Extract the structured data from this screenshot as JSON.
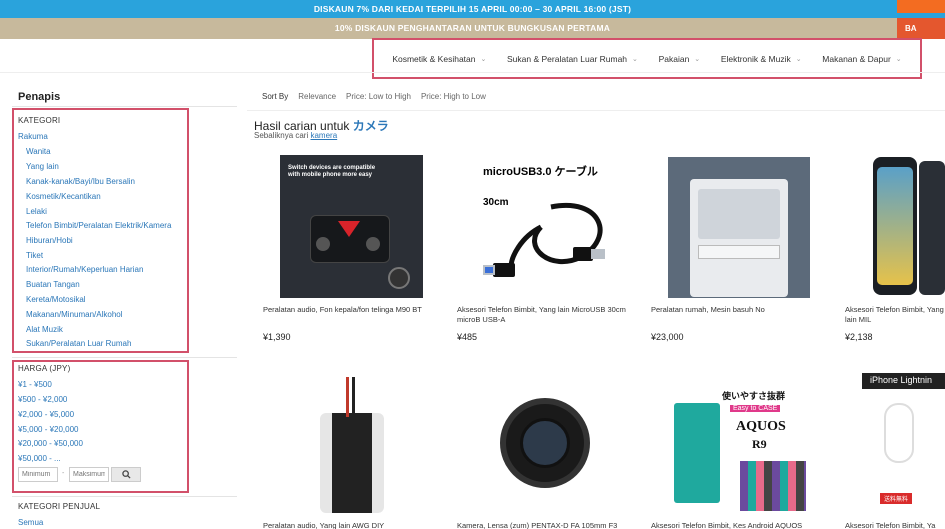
{
  "banners": {
    "top": "DISKAUN 7% DARI KEDAI TERPILIH 15 APRIL 00:00 – 30 APRIL 16:00 (JST)",
    "second": "10% DISKAUN PENGHANTARAN UNTUK BUNGKUSAN PERTAMA",
    "side_second": "BA"
  },
  "nav": {
    "items": [
      "Kosmetik & Kesihatan",
      "Sukan & Peralatan Luar Rumah",
      "Pakaian",
      "Elektronik & Muzik",
      "Makanan & Dapur"
    ]
  },
  "sidebar": {
    "title": "Penapis",
    "kategori": {
      "heading": "KATEGORI",
      "root": "Rakuma",
      "items": [
        "Wanita",
        "Yang lain",
        "Kanak-kanak/Bayi/Ibu Bersalin",
        "Kosmetik/Kecantikan",
        "Lelaki",
        "Telefon Bimbit/Peralatan Elektrik/Kamera",
        "Hiburan/Hobi",
        "Tiket",
        "Interior/Rumah/Keperluan Harian",
        "Buatan Tangan",
        "Kereta/Motosikal",
        "Makanan/Minuman/Alkohol",
        "Alat Muzik",
        "Sukan/Peralatan Luar Rumah"
      ]
    },
    "harga": {
      "heading": "HARGA (JPY)",
      "ranges": [
        "¥1 - ¥500",
        "¥500 - ¥2,000",
        "¥2,000 - ¥5,000",
        "¥5,000 - ¥20,000",
        "¥20,000 - ¥50,000",
        "¥50,000 - ..."
      ],
      "min_placeholder": "Minimum",
      "max_placeholder": "Maksimum",
      "dash": "-"
    },
    "penjual": {
      "heading": "KATEGORI PENJUAL",
      "first": "Semua"
    }
  },
  "sort": {
    "label": "Sort By",
    "options": [
      "Relevance",
      "Price: Low to High",
      "Price: High to Low"
    ]
  },
  "results": {
    "prefix": "Hasil carian untuk ",
    "keyword": "カメラ",
    "alt_prefix": "Sebaliknya cari ",
    "alt_keyword": "kamera"
  },
  "products": [
    {
      "name": "Peralatan audio, Fon kepala/fon telinga M90 BT",
      "price": "¥1,390",
      "img_text": "Switch devices are compatible with mobile phone more easy"
    },
    {
      "name": "Aksesori Telefon Bimbit, Yang lain MicroUSB 30cm microB USB-A",
      "price": "¥485",
      "img_text": "microUSB3.0 ケーブル",
      "img_text2": "30cm"
    },
    {
      "name": "Peralatan rumah, Mesin basuh No",
      "price": "¥23,000"
    },
    {
      "name": "Aksesori Telefon Bimbit, Yang lain MIL",
      "price": "¥2,138"
    },
    {
      "name": "Peralatan audio, Yang lain AWG DIY",
      "price": ""
    },
    {
      "name": "Kamera, Lensa (zum) PENTAX-D FA 105mm F3",
      "price": ""
    },
    {
      "name": "Aksesori Telefon Bimbit, Kes Android AQUOS",
      "price": "",
      "img_text": "使いやすさ抜群",
      "img_text2": "Easy to CASE",
      "img_text3": "AQUOS",
      "img_text4": "R9"
    },
    {
      "name": "Aksesori Telefon Bimbit, Ya",
      "price": "",
      "img_text": "iPhone Lightnin",
      "img_text2": "送料無料"
    }
  ],
  "colors": {
    "banner_top": "#2aa3dc",
    "banner_second": "#c7b99c",
    "link": "#2b77b8",
    "highlight": "#d2506a"
  }
}
